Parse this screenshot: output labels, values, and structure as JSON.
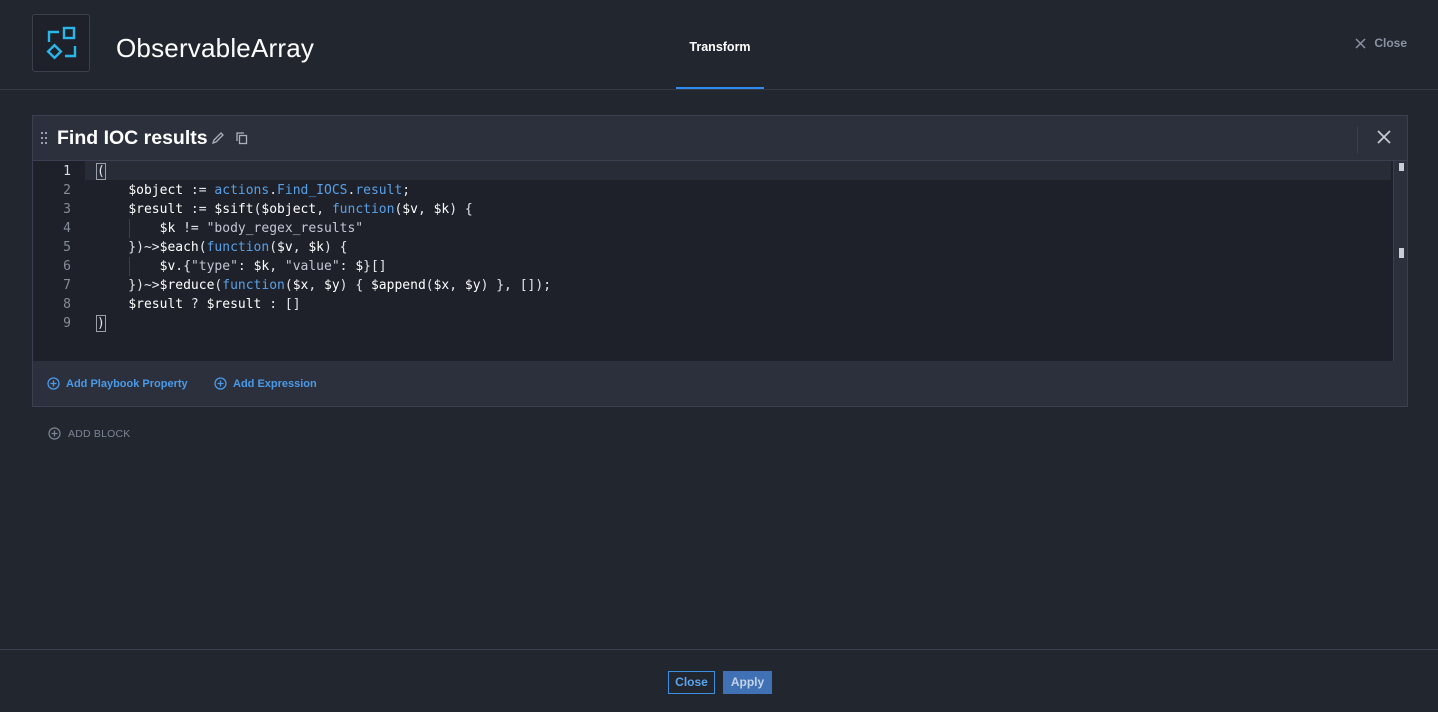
{
  "header": {
    "app_title": "ObservableArray",
    "tab_label": "Transform",
    "close_label": "Close"
  },
  "block": {
    "title": "Find IOC results",
    "code_lines": [
      "(",
      "    $object := actions.Find_IOCS.result;",
      "    $result := $sift($object, function($v, $k) {",
      "        $k != \"body_regex_results\"",
      "    })~>$each(function($v, $k) {",
      "        $v.{\"type\": $k, \"value\": $}[]",
      "    })~>$reduce(function($x, $y) { $append($x, $y) }, []);",
      "    $result ? $result : []",
      ")"
    ],
    "line_numbers": [
      "1",
      "2",
      "3",
      "4",
      "5",
      "6",
      "7",
      "8",
      "9"
    ],
    "add_property_label": "Add Playbook Property",
    "add_expression_label": "Add Expression"
  },
  "add_block_label": "ADD BLOCK",
  "footer": {
    "close_label": "Close",
    "apply_label": "Apply"
  },
  "colors": {
    "accent": "#2d8cf0",
    "keyword": "#5aa0e6",
    "background": "#22262f",
    "editor_background": "#1e212a"
  }
}
